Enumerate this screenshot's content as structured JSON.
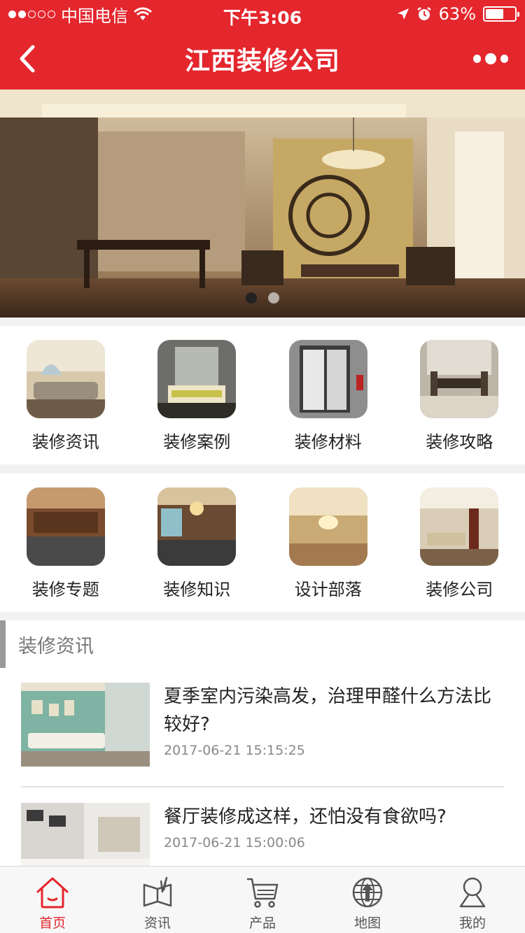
{
  "status": {
    "carrier": "中国电信",
    "time": "下午3:06",
    "battery": "63%",
    "battery_level": 0.63,
    "signal_bars": 2
  },
  "header": {
    "title": "江西装修公司",
    "back_icon": "chevron-left-icon",
    "more_icon": "more-dots-icon"
  },
  "banner": {
    "slides": 2,
    "active_slide": 0
  },
  "categories": [
    {
      "label": "装修资讯"
    },
    {
      "label": "装修案例"
    },
    {
      "label": "装修材料"
    },
    {
      "label": "装修攻略"
    },
    {
      "label": "装修专题"
    },
    {
      "label": "装修知识"
    },
    {
      "label": "设计部落"
    },
    {
      "label": "装修公司"
    }
  ],
  "news": {
    "section_title": "装修资讯",
    "items": [
      {
        "title": "夏季室内污染高发，治理甲醛什么方法比较好?",
        "date": "2017-06-21 15:15:25"
      },
      {
        "title": "餐厅装修成这样，还怕没有食欲吗?",
        "date": "2017-06-21 15:00:06"
      }
    ]
  },
  "tabs": [
    {
      "label": "首页",
      "icon": "home-icon",
      "active": true
    },
    {
      "label": "资讯",
      "icon": "news-icon",
      "active": false
    },
    {
      "label": "产品",
      "icon": "cart-icon",
      "active": false
    },
    {
      "label": "地图",
      "icon": "map-icon",
      "active": false
    },
    {
      "label": "我的",
      "icon": "user-icon",
      "active": false
    }
  ],
  "colors": {
    "brand": "#e4262d",
    "text": "#222222",
    "muted": "#888888"
  }
}
